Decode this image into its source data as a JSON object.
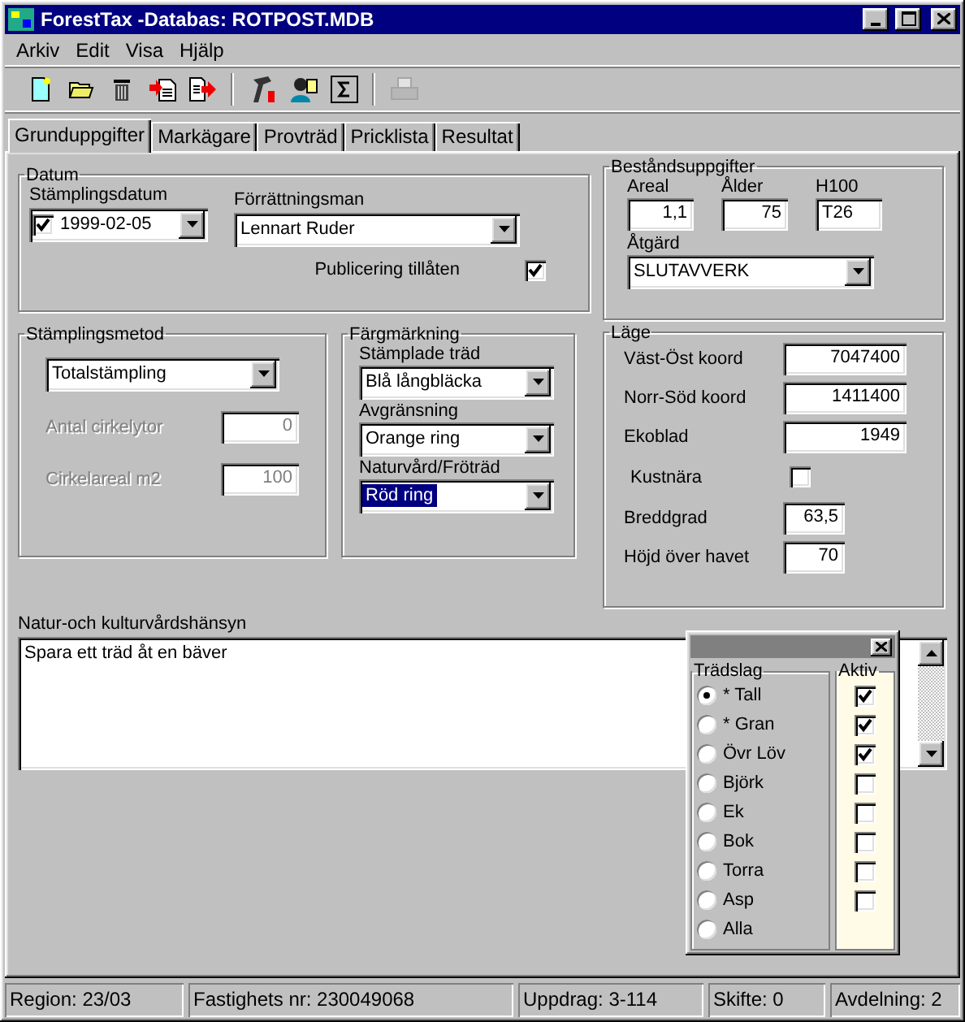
{
  "window": {
    "title": "ForestTax -Databas: ROTPOST.MDB"
  },
  "menu": [
    "Arkiv",
    "Edit",
    "Visa",
    "Hjälp"
  ],
  "toolbar": [
    {
      "kind": "new",
      "disabled": false
    },
    {
      "kind": "open",
      "disabled": false
    },
    {
      "kind": "delete",
      "disabled": false
    },
    {
      "kind": "import",
      "disabled": false
    },
    {
      "kind": "export",
      "disabled": false
    },
    {
      "kind": "tools",
      "disabled": false
    },
    {
      "kind": "people",
      "disabled": false
    },
    {
      "kind": "sum",
      "disabled": false
    },
    {
      "kind": "print",
      "disabled": true
    }
  ],
  "tabs": [
    {
      "label": "Grunduppgifter",
      "selected": true
    },
    {
      "label": "Markägare",
      "selected": false
    },
    {
      "label": "Provträd",
      "selected": false
    },
    {
      "label": "Pricklista",
      "selected": false
    },
    {
      "label": "Resultat",
      "selected": false
    }
  ],
  "datum": {
    "title": "Datum",
    "date_label": "Stämplingsdatum",
    "date_checked": true,
    "date": "1999-02-05",
    "inspector_label": "Förrättningsman",
    "inspector": "Lennart Ruder",
    "publish_label": "Publicering tillåten",
    "publish_checked": true
  },
  "method": {
    "title": "Stämplingsmetod",
    "value": "Totalstämpling",
    "fields": [
      {
        "label": "Antal cirkelytor",
        "value": "0",
        "disabled": true
      },
      {
        "label": "Cirkelareal m2",
        "value": "100",
        "disabled": true
      }
    ]
  },
  "color_marking": {
    "title": "Färgmärkning",
    "fields": [
      {
        "label": "Stämplade träd",
        "value": "Blå långbläcka",
        "selected": false
      },
      {
        "label": "Avgränsning",
        "value": "Orange ring",
        "selected": false
      },
      {
        "label": "Naturvård/Fröträd",
        "value": "Röd ring",
        "selected": true
      }
    ]
  },
  "stand": {
    "title": "Beståndsuppgifter",
    "fields": [
      {
        "label": "Areal",
        "value": "1,1",
        "kind": "number"
      },
      {
        "label": "Ålder",
        "value": "75",
        "kind": "number"
      },
      {
        "label": "H100",
        "value": "T26",
        "kind": "text"
      }
    ],
    "action_label": "Åtgärd",
    "action": "SLUTAVVERK"
  },
  "location": {
    "title": "Läge",
    "rows": [
      {
        "kind": "wide",
        "label": "Väst-Öst koord",
        "value": "7047400"
      },
      {
        "kind": "wide",
        "label": "Norr-Söd koord",
        "value": "1411400"
      },
      {
        "kind": "wide",
        "label": "Ekoblad",
        "value": "1949"
      },
      {
        "kind": "checkbox",
        "label": "Kustnära",
        "checked": false
      },
      {
        "kind": "short",
        "label": "Breddgrad",
        "value": "63,5"
      },
      {
        "kind": "short",
        "label": "Höjd över havet",
        "value": "70"
      }
    ]
  },
  "notes": {
    "label": "Natur-och kulturvårdshänsyn",
    "value": "Spara ett träd åt en bäver"
  },
  "tree_palette": {
    "species_title": "Trädslag",
    "active_title": "Aktiv",
    "rows": [
      {
        "kind": "species",
        "name": "* Tall",
        "selected": true,
        "active": true
      },
      {
        "kind": "species",
        "name": "* Gran",
        "selected": false,
        "active": true
      },
      {
        "kind": "species",
        "name": "Övr Löv",
        "selected": false,
        "active": true
      },
      {
        "kind": "species",
        "name": "Björk",
        "selected": false,
        "active": false
      },
      {
        "kind": "species",
        "name": "Ek",
        "selected": false,
        "active": false
      },
      {
        "kind": "species",
        "name": "Bok",
        "selected": false,
        "active": false
      },
      {
        "kind": "species",
        "name": "Torra",
        "selected": false,
        "active": false
      },
      {
        "kind": "species",
        "name": "Asp",
        "selected": false,
        "active": false
      },
      {
        "kind": "all",
        "name": "Alla",
        "selected": false
      }
    ]
  },
  "status_bar": [
    "Region: 23/03",
    "Fastighets nr: 230049068",
    "Uppdrag: 3-114",
    "Skifte: 0",
    "Avdelning: 2"
  ]
}
